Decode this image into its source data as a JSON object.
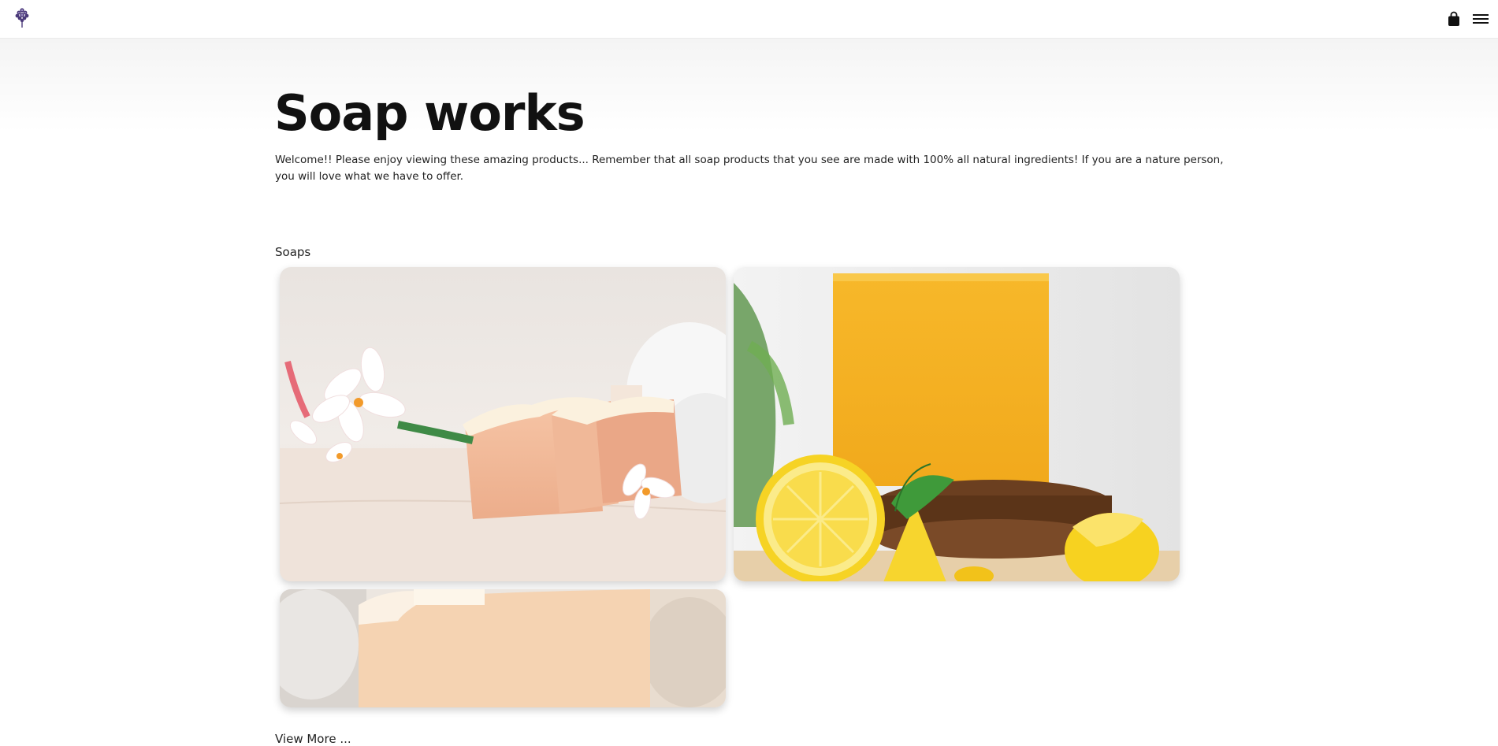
{
  "header": {
    "logo_icon": "lavender-logo-icon",
    "cart_icon": "shopping-bag-icon",
    "menu_icon": "hamburger-menu-icon"
  },
  "hero": {
    "title": "Soap works",
    "intro": "Welcome!! Please enjoy viewing these amazing products... Remember that all soap products that you see are made with 100% all natural ingredients! If you are a nature person, you will love what we have to offer."
  },
  "products": {
    "section_label": "Soaps",
    "items": [
      {
        "image": "peach soap bars with frangipani flowers"
      },
      {
        "image": "yellow lemon soap bar with lemons"
      },
      {
        "image": "cream soap bar on towel"
      }
    ],
    "view_more": "View More ..."
  },
  "colors": {
    "accent": "#4b3a7a",
    "text": "#1a1a1a"
  }
}
